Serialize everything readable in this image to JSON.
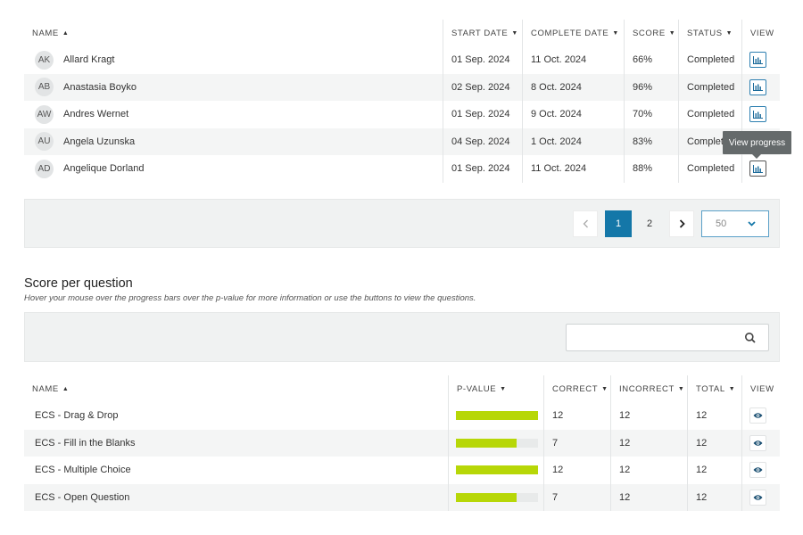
{
  "participants": {
    "columns": {
      "name": "NAME",
      "start_date": "START DATE",
      "complete_date": "COMPLETE DATE",
      "score": "SCORE",
      "status": "STATUS",
      "view": "VIEW"
    },
    "rows": [
      {
        "initials": "AK",
        "name": "Allard Kragt",
        "start": "01 Sep. 2024",
        "complete": "11 Oct. 2024",
        "score": "66%",
        "status": "Completed"
      },
      {
        "initials": "AB",
        "name": "Anastasia Boyko",
        "start": "02 Sep. 2024",
        "complete": "8 Oct. 2024",
        "score": "96%",
        "status": "Completed"
      },
      {
        "initials": "AW",
        "name": "Andres Wernet",
        "start": "01 Sep. 2024",
        "complete": "9 Oct. 2024",
        "score": "70%",
        "status": "Completed"
      },
      {
        "initials": "AU",
        "name": "Angela Uzunska",
        "start": "04 Sep. 2024",
        "complete": "1 Oct. 2024",
        "score": "83%",
        "status": "Completed"
      },
      {
        "initials": "AD",
        "name": "Angelique Dorland",
        "start": "01 Sep. 2024",
        "complete": "11 Oct. 2024",
        "score": "88%",
        "status": "Completed"
      }
    ],
    "tooltip": "View progress",
    "view_icon": "bar-chart-icon"
  },
  "pagination": {
    "pages": [
      "1",
      "2"
    ],
    "current_page": "1",
    "page_size": "50",
    "prev_icon": "chevron-left-icon",
    "next_icon": "chevron-right-icon"
  },
  "score_section": {
    "title": "Score per question",
    "subtitle": "Hover your mouse over the progress bars over the p-value for more information or use the buttons to view the questions.",
    "search": {
      "value": "",
      "placeholder": ""
    }
  },
  "questions": {
    "columns": {
      "name": "NAME",
      "pvalue": "P-VALUE",
      "correct": "CORRECT",
      "incorrect": "INCORRECT",
      "total": "TOTAL",
      "view": "VIEW"
    },
    "rows": [
      {
        "name": "ECS - Drag & Drop",
        "pvalue": 1.0,
        "correct": "12",
        "incorrect": "12",
        "total": "12"
      },
      {
        "name": "ECS - Fill in the Blanks",
        "pvalue": 0.74,
        "correct": "7",
        "incorrect": "12",
        "total": "12"
      },
      {
        "name": "ECS - Multiple Choice",
        "pvalue": 1.0,
        "correct": "12",
        "incorrect": "12",
        "total": "12"
      },
      {
        "name": "ECS - Open Question",
        "pvalue": 0.74,
        "correct": "7",
        "incorrect": "12",
        "total": "12"
      }
    ],
    "view_icon": "eye-icon"
  },
  "colors": {
    "accent": "#1477a8",
    "progress": "#b7d707",
    "tooltip": "#656a6b"
  }
}
